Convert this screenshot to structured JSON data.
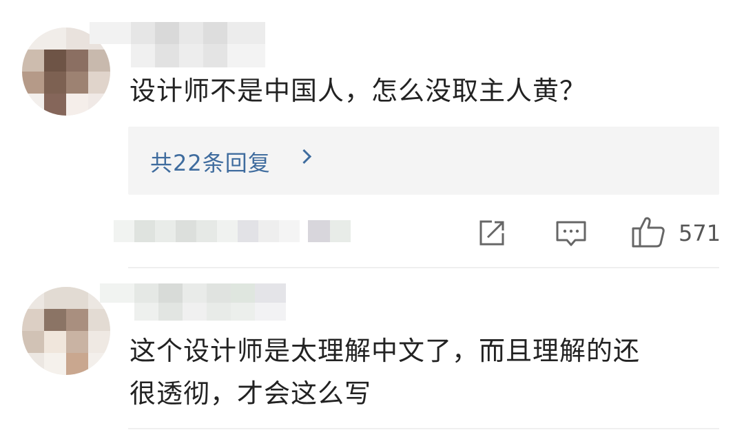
{
  "comments": [
    {
      "text": "设计师不是中国人，怎么没取主人黄？",
      "replies_label": "共22条回复",
      "likes": "571",
      "icons": [
        "share-icon",
        "comment-icon",
        "like-icon",
        "chevron-right-icon"
      ]
    },
    {
      "text_line1": "这个设计师是太理解中文了，而且理解的还",
      "text_line2": "很透彻，才会这么写"
    }
  ],
  "colors": {
    "link": "#3f6c9e",
    "text": "#222222",
    "muted": "#555555",
    "reply_bg": "#f4f4f4"
  }
}
